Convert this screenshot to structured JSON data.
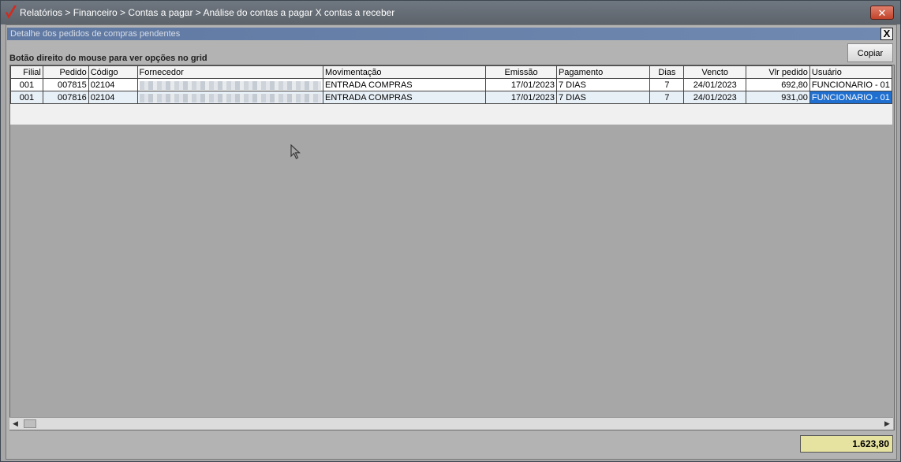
{
  "window": {
    "title": "Relatórios > Financeiro > Contas a pagar > Análise do contas a pagar X contas a receber",
    "close_glyph": "✕"
  },
  "section": {
    "title": "Detalhe dos pedidos de compras pendentes",
    "close_glyph": "X",
    "hint": "Botão direito do mouse para ver opções no grid",
    "copy_label": "Copiar"
  },
  "grid": {
    "columns": [
      "Filial",
      "Pedido",
      "Código",
      "Fornecedor",
      "Movimentação",
      "Emissão",
      "Pagamento",
      "Dias",
      "Vencto",
      "Vlr pedido",
      "Usuário"
    ],
    "rows": [
      {
        "filial": "001",
        "pedido": "007815",
        "codigo": "02104",
        "fornecedor": "",
        "movimentacao": "ENTRADA COMPRAS",
        "emissao": "17/01/2023",
        "pagamento": "7 DIAS",
        "dias": "7",
        "vencto": "24/01/2023",
        "vlr_pedido": "692,80",
        "usuario": "FUNCIONARIO - 01"
      },
      {
        "filial": "001",
        "pedido": "007816",
        "codigo": "02104",
        "fornecedor": "",
        "movimentacao": "ENTRADA COMPRAS",
        "emissao": "17/01/2023",
        "pagamento": "7 DIAS",
        "dias": "7",
        "vencto": "24/01/2023",
        "vlr_pedido": "931,00",
        "usuario": "FUNCIONARIO - 01"
      }
    ]
  },
  "scrollbar": {
    "left_arrow": "◀",
    "right_arrow": "▶"
  },
  "total": "1.623,80",
  "colors": {
    "selection": "#1f6fd0",
    "header_bar": "#5f79a3",
    "total_bg": "#e6e2a0"
  },
  "icons": {
    "app": "red-check-logo-icon",
    "cursor": "mouse-pointer-icon"
  }
}
